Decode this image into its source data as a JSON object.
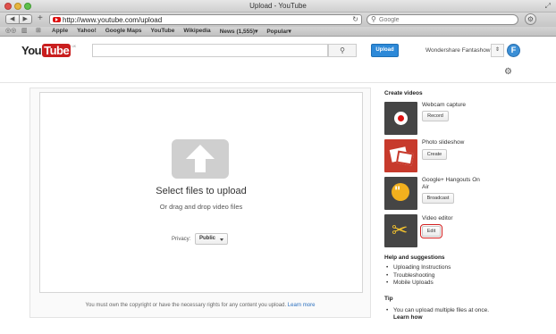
{
  "browser": {
    "window_title": "Upload - YouTube",
    "url": "http://www.youtube.com/upload",
    "search_placeholder": "Google",
    "bookmarks": [
      "Apple",
      "Yahoo!",
      "Google Maps",
      "YouTube",
      "Wikipedia",
      "News (1,555)▾",
      "Popular▾"
    ]
  },
  "header": {
    "logo_you": "You",
    "logo_tube": "Tube",
    "logo_sup": "UK",
    "upload_label": "Upload",
    "account_name": "Wondershare Fantashow",
    "avatar_letter": "F"
  },
  "upload": {
    "select_files": "Select files to upload",
    "drag_drop": "Or drag and drop video files",
    "privacy_label": "Privacy:",
    "privacy_value": "Public",
    "copyright_text": "You must own the copyright or have the necessary rights for any content you upload.",
    "learn_more": "Learn more"
  },
  "sidebar": {
    "create_title": "Create videos",
    "tools": [
      {
        "name": "Webcam capture",
        "button": "Record"
      },
      {
        "name": "Photo slideshow",
        "button": "Create"
      },
      {
        "name": "Google+ Hangouts On Air",
        "button": "Broadcast"
      },
      {
        "name": "Video editor",
        "button": "Edit"
      }
    ],
    "help_title": "Help and suggestions",
    "help_links": [
      "Uploading Instructions",
      "Troubleshooting",
      "Mobile Uploads"
    ],
    "tip_title": "Tip",
    "tip_text": "You can upload multiple files at once.",
    "learn_how": "Learn how"
  }
}
